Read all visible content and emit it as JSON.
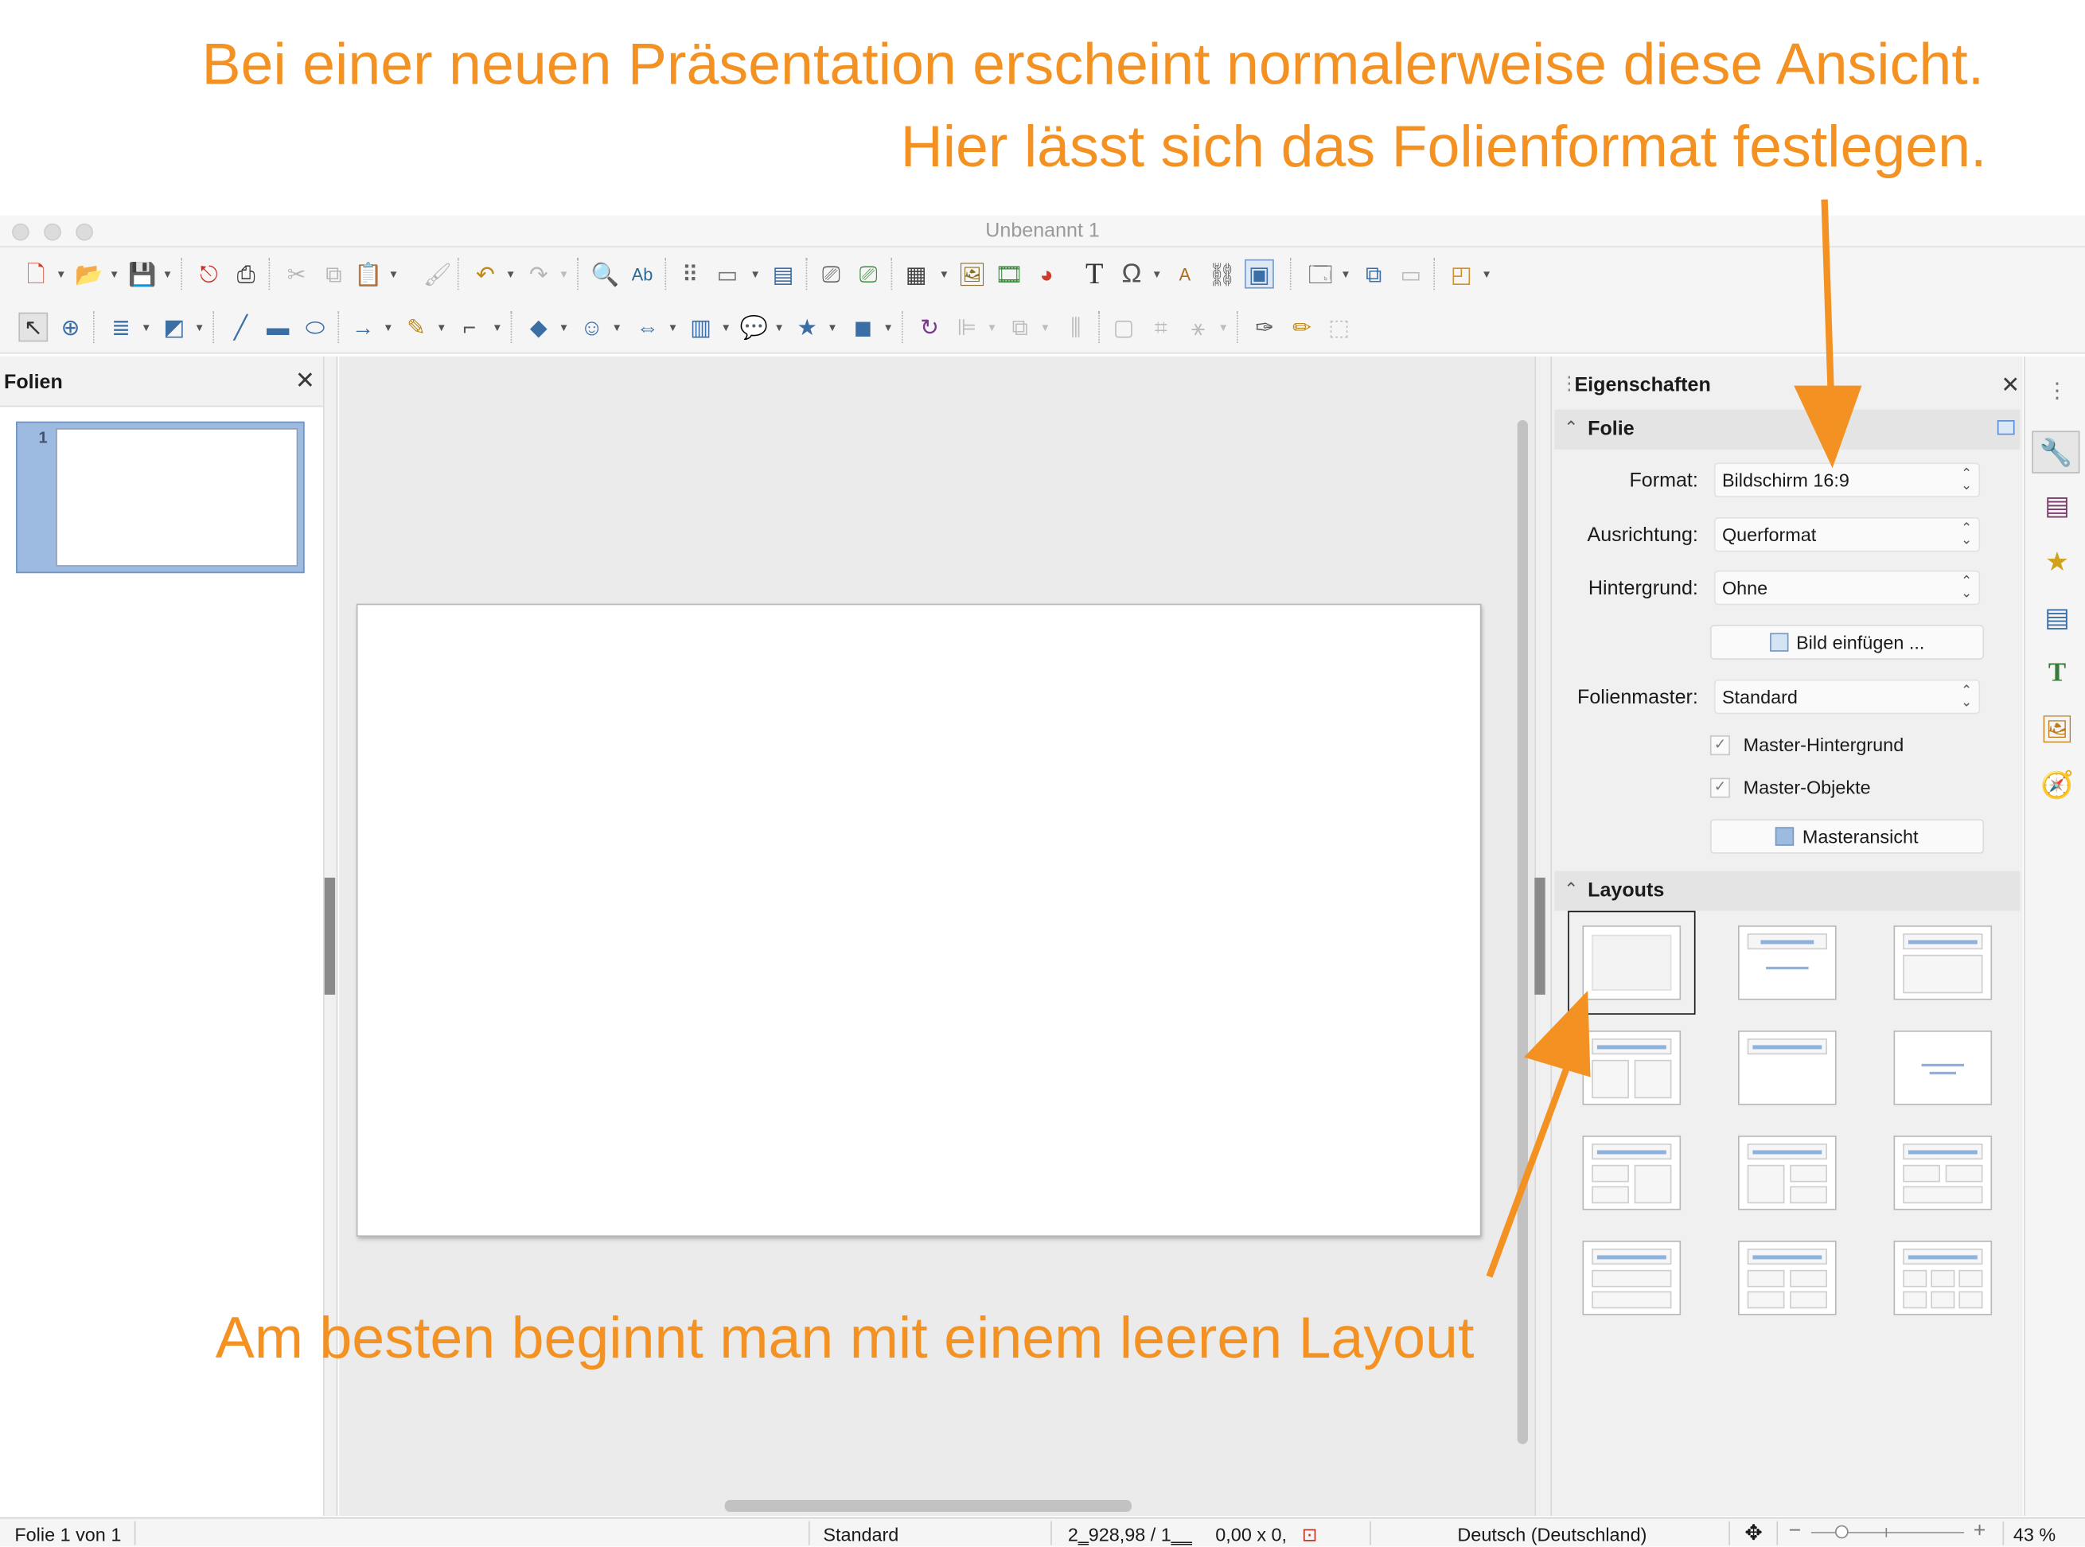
{
  "annotations": {
    "line1": "Bei einer neuen Präsentation erscheint normalerweise diese Ansicht.",
    "line2": "Hier lässt sich das Folienformat festlegen.",
    "line3": "Am besten beginnt man mit einem leeren Layout"
  },
  "window": {
    "title": "Unbenannt 1"
  },
  "slides_panel": {
    "title": "Folien",
    "close": "✕",
    "slides": [
      {
        "number": "1"
      }
    ]
  },
  "properties": {
    "title": "Eigenschaften",
    "close": "✕",
    "folie_section": {
      "label": "Folie",
      "format_label": "Format:",
      "format_value": "Bildschirm 16:9",
      "orientation_label": "Ausrichtung:",
      "orientation_value": "Querformat",
      "background_label": "Hintergrund:",
      "background_value": "Ohne",
      "insert_image_button": "Bild einfügen ...",
      "master_label": "Folienmaster:",
      "master_value": "Standard",
      "master_background_check": "Master-Hintergrund",
      "master_objects_check": "Master-Objekte",
      "master_view_button": "Masteransicht"
    },
    "layouts_section": {
      "label": "Layouts"
    }
  },
  "statusbar": {
    "slide_info": "Folie 1 von 1",
    "master": "Standard",
    "position": "2‗928,98 / 1‗‗",
    "size": "0,00 x 0,",
    "language": "Deutsch (Deutschland)",
    "zoom_minus": "−",
    "zoom_plus": "+",
    "zoom": "43 %"
  },
  "colors": {
    "annotation": "#f39222",
    "accent_blue": "#3a6ea5",
    "slide_selection": "#9dbbe0"
  }
}
